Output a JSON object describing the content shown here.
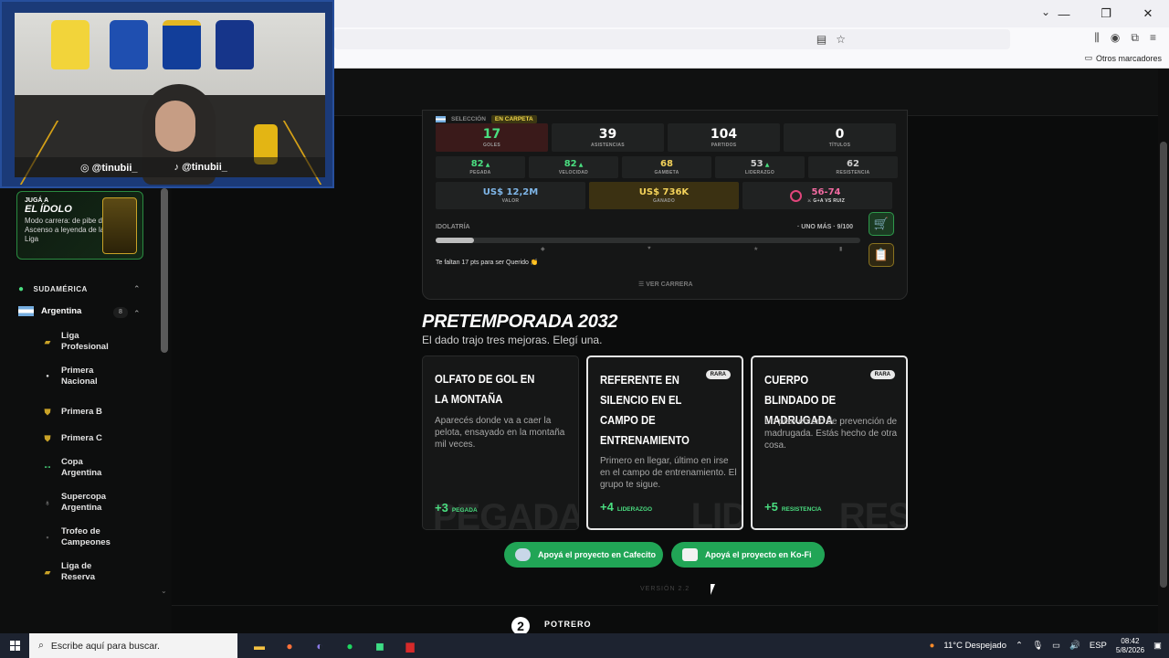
{
  "browser": {
    "bookmarks_other": "Otros marcadores"
  },
  "webcam": {
    "instagram": "@tinubii_",
    "tiktok": "@tinubii_"
  },
  "sidebar": {
    "promo": {
      "kicker": "JUGÁ A",
      "title": "EL ÍDOLO",
      "desc": "Modo carrera: de pibe del Ascenso a leyenda de la Liga"
    },
    "region": "SUDAMÉRICA",
    "country": "Argentina",
    "country_count": "8",
    "items": [
      {
        "label": "Liga Profesional"
      },
      {
        "label": "Primera Nacional"
      },
      {
        "label": "Primera B"
      },
      {
        "label": "Primera C"
      },
      {
        "label": "Copa Argentina"
      },
      {
        "label": "Supercopa Argentina"
      },
      {
        "label": "Trofeo de Campeones"
      },
      {
        "label": "Liga de Reserva"
      }
    ]
  },
  "career": {
    "tag1": "SELECCIÓN",
    "tag2": "EN CARPETA",
    "main_stats": [
      {
        "value": "17",
        "label": "GOLES"
      },
      {
        "value": "39",
        "label": "ASISTENCIAS"
      },
      {
        "value": "104",
        "label": "PARTIDOS"
      },
      {
        "value": "0",
        "label": "TÍTULOS"
      }
    ],
    "attrs": [
      {
        "value": "82",
        "label": "PEGADA"
      },
      {
        "value": "82",
        "label": "VELOCIDAD"
      },
      {
        "value": "68",
        "label": "GAMBETA"
      },
      {
        "value": "53",
        "label": "LIDERAZGO"
      },
      {
        "value": "62",
        "label": "RESISTENCIA"
      }
    ],
    "money": [
      {
        "value": "US$ 12,2M",
        "label": "VALOR"
      },
      {
        "value": "US$ 736K",
        "label": "GANADO"
      }
    ],
    "rival": {
      "value": "56-74",
      "label": "G+A VS RUIZ"
    },
    "idolatry_label": "IDOLATRÍA",
    "idolatry_right": "· UNO MÁS · 9/100",
    "idolatry_progress": 0.09,
    "hint": "Te faltan 17 pts para ser Querido 👏",
    "see_career": "VER CARRERA"
  },
  "preseason": {
    "title": "PRETEMPORADA 2032",
    "subtitle": "El dado trajo tres mejoras. Elegí una.",
    "cards": [
      {
        "title": "Olfato de gol en la montaña",
        "desc": "Aparecés donde va a caer la pelota, ensayado en la montaña mil veces.",
        "rarity": "",
        "bonus": "+3",
        "stat": "PEGADA",
        "watermark": "PEGADA"
      },
      {
        "title": "Referente en silencio en el campo de entrenamiento",
        "desc": "Primero en llegar, último en irse en el campo de entrenamiento. El grupo te sigue.",
        "rarity": "RARA",
        "bonus": "+4",
        "stat": "LIDERAZGO",
        "watermark": "LID"
      },
      {
        "title": "Cuerpo blindado de madrugada",
        "desc": "Un plan entero de prevención de madrugada. Estás hecho de otra cosa.",
        "rarity": "RARA",
        "bonus": "+5",
        "stat": "RESISTENCIA",
        "watermark": "RES"
      }
    ]
  },
  "support": {
    "cafecito": "Apoyá el proyecto en Cafecito",
    "kofi": "Apoyá el proyecto en Ko-Fi"
  },
  "version": "VERSIÓN 2.2",
  "footer": {
    "brand": "POTRERO"
  },
  "taskbar": {
    "search_placeholder": "Escribe aquí para buscar.",
    "weather": "11°C  Despejado",
    "lang": "ESP",
    "time": "08:42",
    "date": "5/8/2026"
  },
  "colors": {
    "accent_green": "#4ade80",
    "button_green": "#21a556",
    "gold": "#f3d25a"
  }
}
